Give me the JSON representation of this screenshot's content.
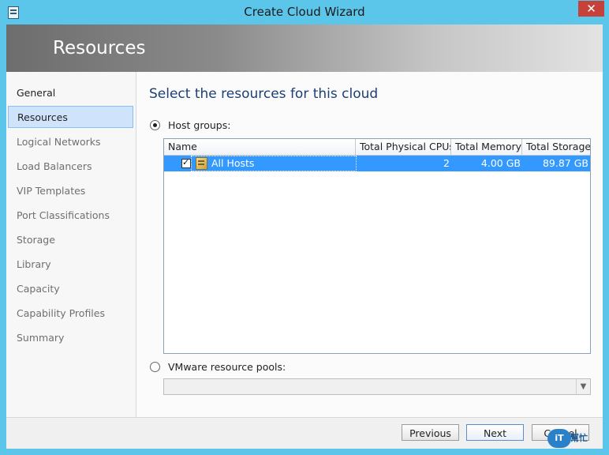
{
  "window": {
    "title": "Create Cloud Wizard",
    "close_label": "✕"
  },
  "banner": {
    "title": "Resources"
  },
  "nav": {
    "items": [
      {
        "label": "General",
        "state": "normal"
      },
      {
        "label": "Resources",
        "state": "active"
      },
      {
        "label": "Logical Networks",
        "state": "disabled"
      },
      {
        "label": "Load Balancers",
        "state": "disabled"
      },
      {
        "label": "VIP Templates",
        "state": "disabled"
      },
      {
        "label": "Port Classifications",
        "state": "disabled"
      },
      {
        "label": "Storage",
        "state": "disabled"
      },
      {
        "label": "Library",
        "state": "disabled"
      },
      {
        "label": "Capacity",
        "state": "disabled"
      },
      {
        "label": "Capability Profiles",
        "state": "disabled"
      },
      {
        "label": "Summary",
        "state": "disabled"
      }
    ]
  },
  "main": {
    "heading": "Select the resources for this cloud",
    "host_groups_radio": "Host groups:",
    "vmware_radio": "VMware resource pools:"
  },
  "grid": {
    "columns": [
      "Name",
      "Total Physical CPUs",
      "Total Memory",
      "Total Storage"
    ],
    "rows": [
      {
        "name": "All Hosts",
        "cpus": "2",
        "memory": "4.00 GB",
        "storage": "89.87 GB"
      }
    ]
  },
  "footer": {
    "previous": "Previous",
    "next": "Next",
    "cancel": "Cancel"
  },
  "logo": {
    "mark": "iT",
    "text": "幫忙"
  }
}
